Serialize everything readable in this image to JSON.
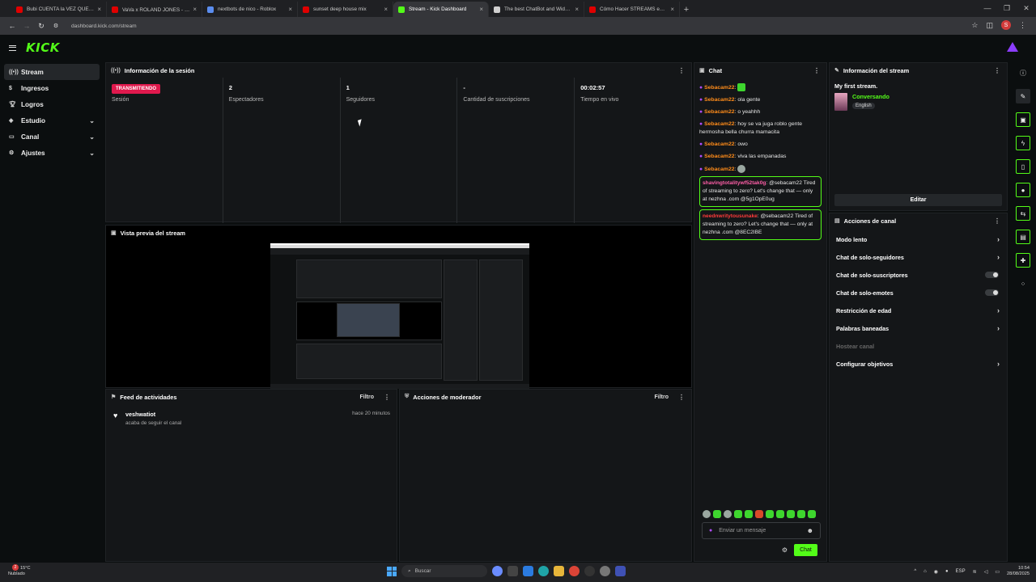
{
  "browser": {
    "tabs": [
      {
        "label": "Bubi CUENTA la VEZ QUE CASI",
        "color": "#e00000"
      },
      {
        "label": "VaVa x ROLAND JONES - 来生",
        "color": "#e00000"
      },
      {
        "label": "nextbots de nico - Roblox",
        "color": "#5b8def"
      },
      {
        "label": "sunset deep house mix",
        "color": "#e00000"
      },
      {
        "label": "Stream - Kick Dashboard",
        "color": "#53fc18"
      },
      {
        "label": "The best ChatBot and Widgets",
        "color": "#cfcfcf"
      },
      {
        "label": "Cómo Hacer STREAMS en K",
        "color": "#e00000"
      }
    ],
    "url": "dashboard.kick.com/stream",
    "profile_initial": "S"
  },
  "app": {
    "logo": "KICK"
  },
  "sidebar": {
    "items": [
      {
        "label": "Stream",
        "icon": "broadcast-icon"
      },
      {
        "label": "Ingresos",
        "icon": "money-icon"
      },
      {
        "label": "Logros",
        "icon": "trophy-icon"
      },
      {
        "label": "Estudio",
        "icon": "studio-icon"
      },
      {
        "label": "Canal",
        "icon": "channel-icon"
      },
      {
        "label": "Ajustes",
        "icon": "gear-icon"
      }
    ]
  },
  "session": {
    "title": "Información de la sesión",
    "badge": "TRANSMITIENDO",
    "stats": [
      {
        "value": "",
        "label": "Sesión"
      },
      {
        "value": "2",
        "label": "Espectadores"
      },
      {
        "value": "1",
        "label": "Seguidores"
      },
      {
        "value": "-",
        "label": "Cantidad de suscripciones"
      },
      {
        "value": "00:02:57",
        "label": "Tiempo en vivo"
      }
    ]
  },
  "preview": {
    "title": "Vista previa del stream"
  },
  "feed": {
    "title": "Feed de actividades",
    "filter": "Filtro",
    "items": [
      {
        "name": "veshwatiot",
        "action": "acaba de seguir el canal",
        "time": "hace 20 minutos"
      }
    ]
  },
  "mod": {
    "title": "Acciones de moderador",
    "filter": "Filtro"
  },
  "chat": {
    "title": "Chat",
    "messages": [
      {
        "user": "Sebacam22",
        "text": ""
      },
      {
        "user": "Sebacam22",
        "text": "ola gente"
      },
      {
        "user": "Sebacam22",
        "text": "o yeahhh"
      },
      {
        "user": "Sebacam22",
        "text": "hoy se va juga roblo gente hermosha bella churra mamacita"
      },
      {
        "user": "Sebacam22",
        "text": "owo"
      },
      {
        "user": "Sebacam22",
        "text": "viva las empanadas"
      },
      {
        "user": "Sebacam22",
        "text": ""
      }
    ],
    "highlight1_user": "shavingtotalitywf52tak0g",
    "highlight1_text": "@sebacam22 Tired of streaming to zero? Let's change that — only at nezhna .com @5g1OpE0ug",
    "highlight2_user": "neednwritytousunake",
    "highlight2_text": "@sebacam22 Tired of streaming to zero? Let's change that — only at nezhna .com @8EC2IBE",
    "placeholder": "Enviar un mensaje",
    "send": "Chat"
  },
  "stream_info": {
    "title": "Información del stream",
    "stream_title": "My first stream.",
    "category": "Conversando",
    "language": "English",
    "edit": "Editar"
  },
  "channel_actions": {
    "title": "Acciones de canal",
    "items": [
      {
        "label": "Modo lento",
        "kind": "arrow"
      },
      {
        "label": "Chat de solo-seguidores",
        "kind": "arrow"
      },
      {
        "label": "Chat de solo-suscriptores",
        "kind": "toggle"
      },
      {
        "label": "Chat de solo-emotes",
        "kind": "toggle"
      },
      {
        "label": "Restricción de edad",
        "kind": "arrow"
      },
      {
        "label": "Palabras baneadas",
        "kind": "arrow"
      },
      {
        "label": "Hostear canal",
        "kind": "disabled"
      },
      {
        "label": "Configurar objetivos",
        "kind": "arrow"
      }
    ]
  },
  "taskbar": {
    "weather_temp": "15°C",
    "weather_text": "Nublado",
    "notif_count": "2",
    "search": "Buscar",
    "lang": "ESP",
    "time": "10:54",
    "date": "28/08/2025"
  },
  "colors": {
    "accent": "#53fc18",
    "live": "#e0194d",
    "user": "#ff8c1a"
  }
}
